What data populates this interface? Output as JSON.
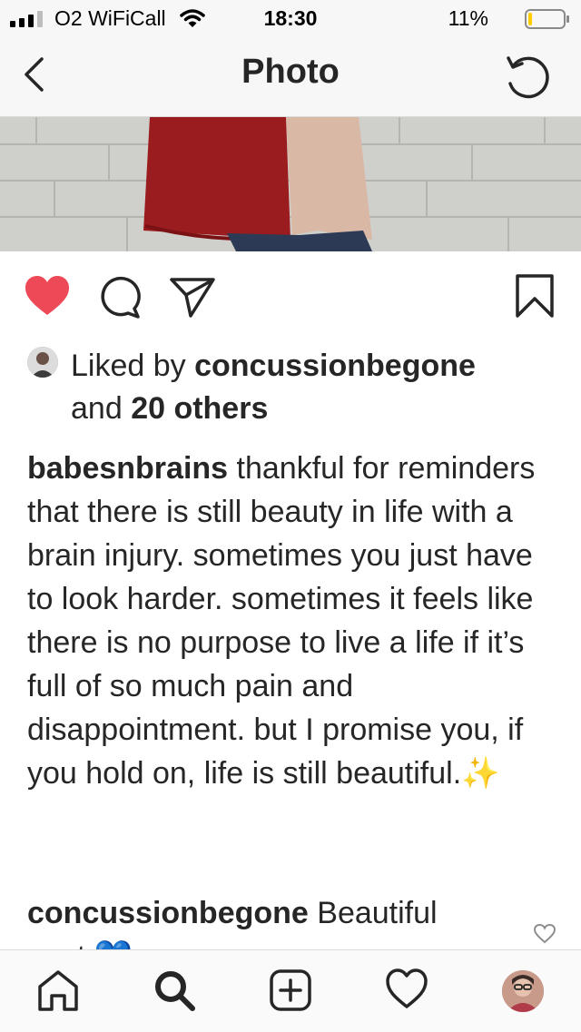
{
  "status_bar": {
    "carrier": "O2 WiFiCall",
    "time": "18:30",
    "battery_percent": "11%",
    "battery_level": 0.11,
    "battery_color": "#ffcc00"
  },
  "nav": {
    "title": "Photo",
    "back_icon": "chevron-left-icon",
    "refresh_icon": "refresh-icon"
  },
  "post": {
    "liked": true,
    "like_color": "#ed4956",
    "likes": {
      "prefix": "Liked by ",
      "user": "concussionbegone",
      "middle": "and ",
      "others": "20 others"
    },
    "caption": {
      "username": "babesnbrains",
      "text": "thankful for reminders that there is still beauty in life with a brain injury. sometimes you just have to look harder. sometimes it feels like there is no purpose to live a life if it’s full of so much pain and disappointment. but I promise you, if you hold on, life is still beautiful.",
      "emoji": "✨"
    },
    "comment": {
      "username": "concussionbegone",
      "text": "Beautiful",
      "second_line": "post",
      "emoji": "💙"
    }
  },
  "tab_bar": {
    "items": [
      "home-icon",
      "search-icon",
      "new-post-icon",
      "activity-icon",
      "profile-avatar"
    ]
  }
}
